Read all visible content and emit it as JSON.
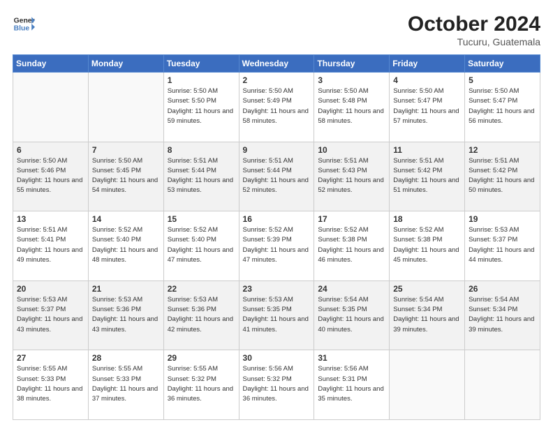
{
  "header": {
    "logo_line1": "General",
    "logo_line2": "Blue",
    "month_title": "October 2024",
    "location": "Tucuru, Guatemala"
  },
  "weekdays": [
    "Sunday",
    "Monday",
    "Tuesday",
    "Wednesday",
    "Thursday",
    "Friday",
    "Saturday"
  ],
  "weeks": [
    [
      {
        "day": "",
        "sunrise": "",
        "sunset": "",
        "daylight": ""
      },
      {
        "day": "",
        "sunrise": "",
        "sunset": "",
        "daylight": ""
      },
      {
        "day": "1",
        "sunrise": "Sunrise: 5:50 AM",
        "sunset": "Sunset: 5:50 PM",
        "daylight": "Daylight: 11 hours and 59 minutes."
      },
      {
        "day": "2",
        "sunrise": "Sunrise: 5:50 AM",
        "sunset": "Sunset: 5:49 PM",
        "daylight": "Daylight: 11 hours and 58 minutes."
      },
      {
        "day": "3",
        "sunrise": "Sunrise: 5:50 AM",
        "sunset": "Sunset: 5:48 PM",
        "daylight": "Daylight: 11 hours and 58 minutes."
      },
      {
        "day": "4",
        "sunrise": "Sunrise: 5:50 AM",
        "sunset": "Sunset: 5:47 PM",
        "daylight": "Daylight: 11 hours and 57 minutes."
      },
      {
        "day": "5",
        "sunrise": "Sunrise: 5:50 AM",
        "sunset": "Sunset: 5:47 PM",
        "daylight": "Daylight: 11 hours and 56 minutes."
      }
    ],
    [
      {
        "day": "6",
        "sunrise": "Sunrise: 5:50 AM",
        "sunset": "Sunset: 5:46 PM",
        "daylight": "Daylight: 11 hours and 55 minutes."
      },
      {
        "day": "7",
        "sunrise": "Sunrise: 5:50 AM",
        "sunset": "Sunset: 5:45 PM",
        "daylight": "Daylight: 11 hours and 54 minutes."
      },
      {
        "day": "8",
        "sunrise": "Sunrise: 5:51 AM",
        "sunset": "Sunset: 5:44 PM",
        "daylight": "Daylight: 11 hours and 53 minutes."
      },
      {
        "day": "9",
        "sunrise": "Sunrise: 5:51 AM",
        "sunset": "Sunset: 5:44 PM",
        "daylight": "Daylight: 11 hours and 52 minutes."
      },
      {
        "day": "10",
        "sunrise": "Sunrise: 5:51 AM",
        "sunset": "Sunset: 5:43 PM",
        "daylight": "Daylight: 11 hours and 52 minutes."
      },
      {
        "day": "11",
        "sunrise": "Sunrise: 5:51 AM",
        "sunset": "Sunset: 5:42 PM",
        "daylight": "Daylight: 11 hours and 51 minutes."
      },
      {
        "day": "12",
        "sunrise": "Sunrise: 5:51 AM",
        "sunset": "Sunset: 5:42 PM",
        "daylight": "Daylight: 11 hours and 50 minutes."
      }
    ],
    [
      {
        "day": "13",
        "sunrise": "Sunrise: 5:51 AM",
        "sunset": "Sunset: 5:41 PM",
        "daylight": "Daylight: 11 hours and 49 minutes."
      },
      {
        "day": "14",
        "sunrise": "Sunrise: 5:52 AM",
        "sunset": "Sunset: 5:40 PM",
        "daylight": "Daylight: 11 hours and 48 minutes."
      },
      {
        "day": "15",
        "sunrise": "Sunrise: 5:52 AM",
        "sunset": "Sunset: 5:40 PM",
        "daylight": "Daylight: 11 hours and 47 minutes."
      },
      {
        "day": "16",
        "sunrise": "Sunrise: 5:52 AM",
        "sunset": "Sunset: 5:39 PM",
        "daylight": "Daylight: 11 hours and 47 minutes."
      },
      {
        "day": "17",
        "sunrise": "Sunrise: 5:52 AM",
        "sunset": "Sunset: 5:38 PM",
        "daylight": "Daylight: 11 hours and 46 minutes."
      },
      {
        "day": "18",
        "sunrise": "Sunrise: 5:52 AM",
        "sunset": "Sunset: 5:38 PM",
        "daylight": "Daylight: 11 hours and 45 minutes."
      },
      {
        "day": "19",
        "sunrise": "Sunrise: 5:53 AM",
        "sunset": "Sunset: 5:37 PM",
        "daylight": "Daylight: 11 hours and 44 minutes."
      }
    ],
    [
      {
        "day": "20",
        "sunrise": "Sunrise: 5:53 AM",
        "sunset": "Sunset: 5:37 PM",
        "daylight": "Daylight: 11 hours and 43 minutes."
      },
      {
        "day": "21",
        "sunrise": "Sunrise: 5:53 AM",
        "sunset": "Sunset: 5:36 PM",
        "daylight": "Daylight: 11 hours and 43 minutes."
      },
      {
        "day": "22",
        "sunrise": "Sunrise: 5:53 AM",
        "sunset": "Sunset: 5:36 PM",
        "daylight": "Daylight: 11 hours and 42 minutes."
      },
      {
        "day": "23",
        "sunrise": "Sunrise: 5:53 AM",
        "sunset": "Sunset: 5:35 PM",
        "daylight": "Daylight: 11 hours and 41 minutes."
      },
      {
        "day": "24",
        "sunrise": "Sunrise: 5:54 AM",
        "sunset": "Sunset: 5:35 PM",
        "daylight": "Daylight: 11 hours and 40 minutes."
      },
      {
        "day": "25",
        "sunrise": "Sunrise: 5:54 AM",
        "sunset": "Sunset: 5:34 PM",
        "daylight": "Daylight: 11 hours and 39 minutes."
      },
      {
        "day": "26",
        "sunrise": "Sunrise: 5:54 AM",
        "sunset": "Sunset: 5:34 PM",
        "daylight": "Daylight: 11 hours and 39 minutes."
      }
    ],
    [
      {
        "day": "27",
        "sunrise": "Sunrise: 5:55 AM",
        "sunset": "Sunset: 5:33 PM",
        "daylight": "Daylight: 11 hours and 38 minutes."
      },
      {
        "day": "28",
        "sunrise": "Sunrise: 5:55 AM",
        "sunset": "Sunset: 5:33 PM",
        "daylight": "Daylight: 11 hours and 37 minutes."
      },
      {
        "day": "29",
        "sunrise": "Sunrise: 5:55 AM",
        "sunset": "Sunset: 5:32 PM",
        "daylight": "Daylight: 11 hours and 36 minutes."
      },
      {
        "day": "30",
        "sunrise": "Sunrise: 5:56 AM",
        "sunset": "Sunset: 5:32 PM",
        "daylight": "Daylight: 11 hours and 36 minutes."
      },
      {
        "day": "31",
        "sunrise": "Sunrise: 5:56 AM",
        "sunset": "Sunset: 5:31 PM",
        "daylight": "Daylight: 11 hours and 35 minutes."
      },
      {
        "day": "",
        "sunrise": "",
        "sunset": "",
        "daylight": ""
      },
      {
        "day": "",
        "sunrise": "",
        "sunset": "",
        "daylight": ""
      }
    ]
  ]
}
